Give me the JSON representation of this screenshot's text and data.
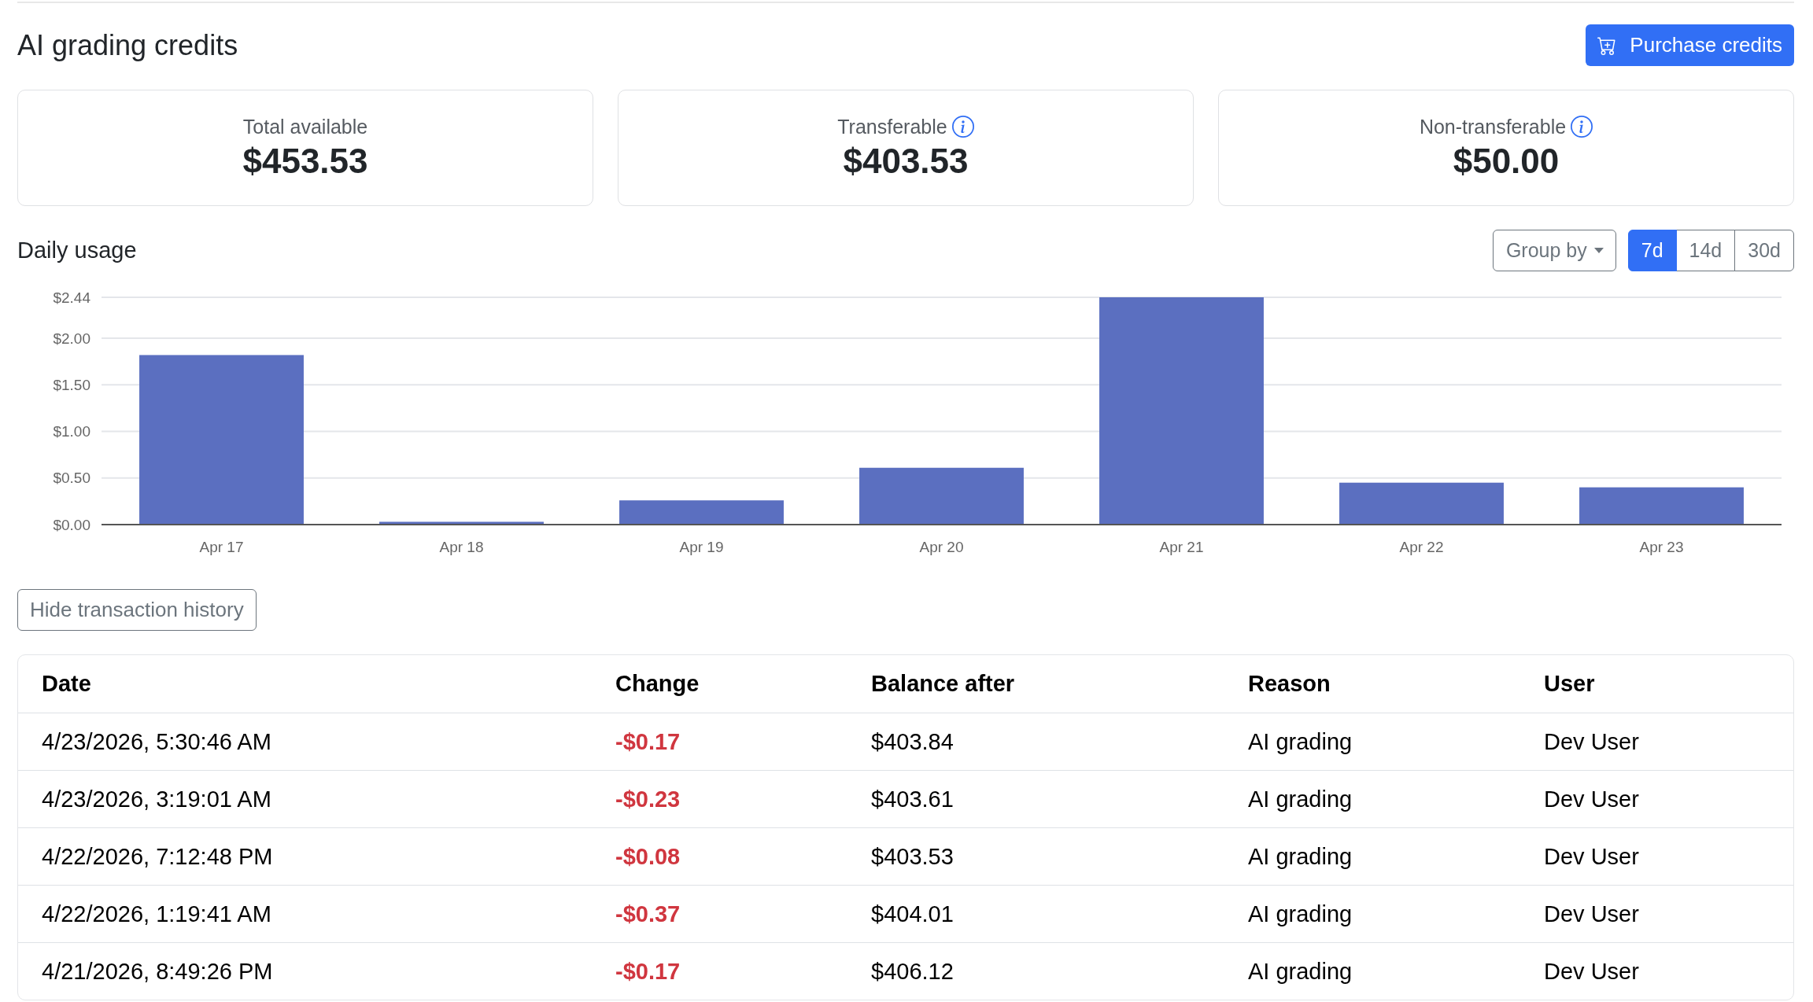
{
  "header": {
    "title": "AI grading credits",
    "purchase_button": "Purchase credits"
  },
  "summary_cards": [
    {
      "label": "Total available",
      "value": "$453.53",
      "has_info": false
    },
    {
      "label": "Transferable",
      "value": "$403.53",
      "has_info": true
    },
    {
      "label": "Non-transferable",
      "value": "$50.00",
      "has_info": true
    }
  ],
  "daily_usage": {
    "title": "Daily usage",
    "group_by": "Group by",
    "ranges": [
      {
        "label": "7d",
        "selected": true
      },
      {
        "label": "14d",
        "selected": false
      },
      {
        "label": "30d",
        "selected": false
      }
    ],
    "chart_data": {
      "type": "bar",
      "categories": [
        "Apr 17",
        "Apr 18",
        "Apr 19",
        "Apr 20",
        "Apr 21",
        "Apr 22",
        "Apr 23"
      ],
      "series": [
        {
          "color": "#5b6fc0",
          "values": [
            1.82,
            0.03,
            0.26,
            0.61,
            2.44,
            0.45,
            0.4
          ]
        }
      ],
      "ylim": [
        0,
        2.44
      ],
      "yticks": [
        {
          "value": 0,
          "label": "$0.00"
        },
        {
          "value": 0.5,
          "label": "$0.50"
        },
        {
          "value": 1,
          "label": "$1.00"
        },
        {
          "value": 1.5,
          "label": "$1.50"
        },
        {
          "value": 2,
          "label": "$2.00"
        },
        {
          "value": 2.44,
          "label": "$2.44"
        }
      ],
      "grid": true
    }
  },
  "history_toggle": "Hide transaction history",
  "transactions": {
    "columns": [
      "Date",
      "Change",
      "Balance after",
      "Reason",
      "User"
    ],
    "rows": [
      {
        "date": "4/23/2026, 5:30:46 AM",
        "change": "-$0.17",
        "balance_after": "$403.84",
        "reason": "AI grading",
        "user": "Dev User"
      },
      {
        "date": "4/23/2026, 3:19:01 AM",
        "change": "-$0.23",
        "balance_after": "$403.61",
        "reason": "AI grading",
        "user": "Dev User"
      },
      {
        "date": "4/22/2026, 7:12:48 PM",
        "change": "-$0.08",
        "balance_after": "$403.53",
        "reason": "AI grading",
        "user": "Dev User"
      },
      {
        "date": "4/22/2026, 1:19:41 AM",
        "change": "-$0.37",
        "balance_after": "$404.01",
        "reason": "AI grading",
        "user": "Dev User"
      },
      {
        "date": "4/21/2026, 8:49:26 PM",
        "change": "-$0.17",
        "balance_after": "$406.12",
        "reason": "AI grading",
        "user": "Dev User"
      }
    ]
  }
}
